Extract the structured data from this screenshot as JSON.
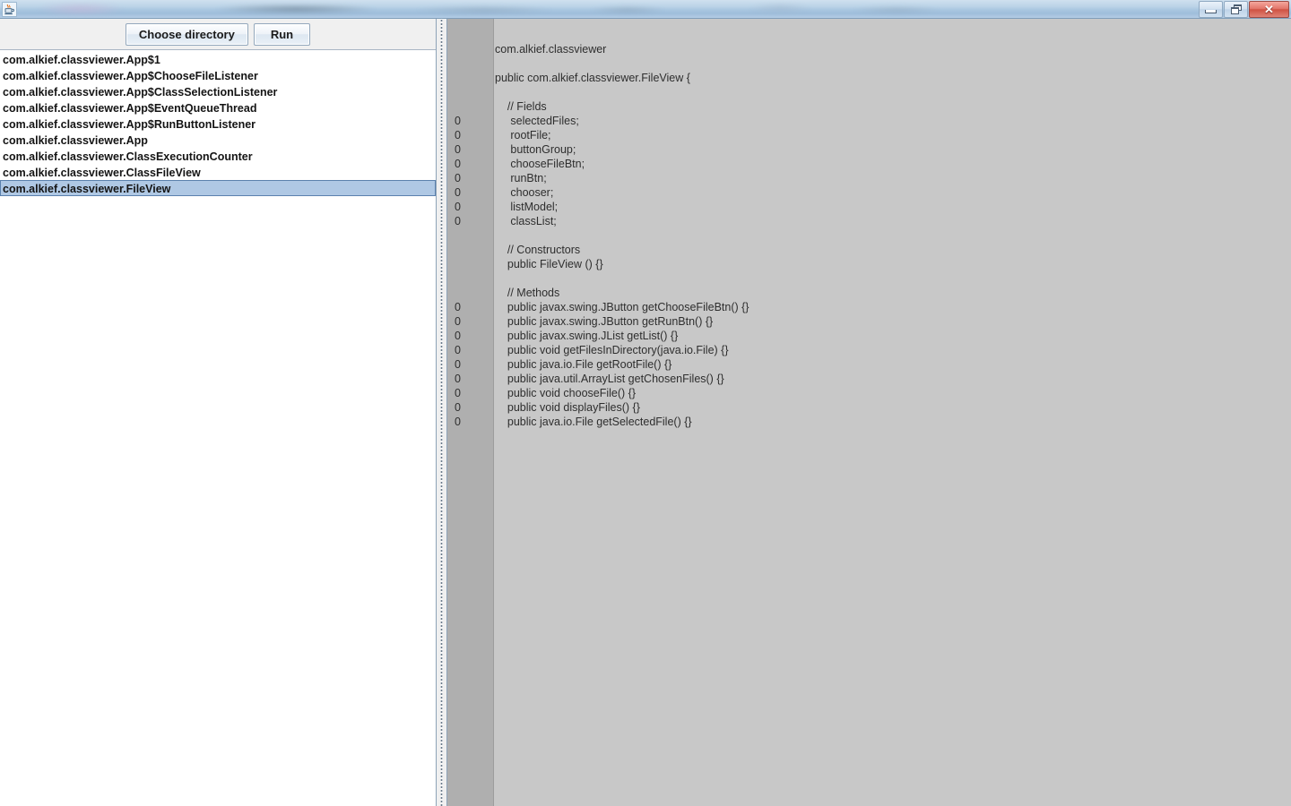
{
  "window": {
    "title": "",
    "app_icon": "java-coffee-cup-icon",
    "controls": {
      "minimize": "minimize-icon",
      "restore": "restore-icon",
      "close": "✕"
    }
  },
  "toolbar": {
    "choose_directory_label": "Choose directory",
    "run_label": "Run"
  },
  "class_list": {
    "items": [
      {
        "label": "com.alkief.classviewer.App$1",
        "selected": false
      },
      {
        "label": "com.alkief.classviewer.App$ChooseFileListener",
        "selected": false
      },
      {
        "label": "com.alkief.classviewer.App$ClassSelectionListener",
        "selected": false
      },
      {
        "label": "com.alkief.classviewer.App$EventQueueThread",
        "selected": false
      },
      {
        "label": "com.alkief.classviewer.App$RunButtonListener",
        "selected": false
      },
      {
        "label": "com.alkief.classviewer.App",
        "selected": false
      },
      {
        "label": "com.alkief.classviewer.ClassExecutionCounter",
        "selected": false
      },
      {
        "label": "com.alkief.classviewer.ClassFileView",
        "selected": false
      },
      {
        "label": "com.alkief.classviewer.FileView",
        "selected": true
      }
    ]
  },
  "code_view": {
    "lines": [
      {
        "text": "com.alkief.classviewer",
        "counter": null
      },
      {
        "text": "",
        "counter": null
      },
      {
        "text": "public com.alkief.classviewer.FileView {",
        "counter": null
      },
      {
        "text": "",
        "counter": null
      },
      {
        "text": "    // Fields",
        "counter": null
      },
      {
        "text": "     selectedFiles;",
        "counter": "0"
      },
      {
        "text": "     rootFile;",
        "counter": "0"
      },
      {
        "text": "     buttonGroup;",
        "counter": "0"
      },
      {
        "text": "     chooseFileBtn;",
        "counter": "0"
      },
      {
        "text": "     runBtn;",
        "counter": "0"
      },
      {
        "text": "     chooser;",
        "counter": "0"
      },
      {
        "text": "     listModel;",
        "counter": "0"
      },
      {
        "text": "     classList;",
        "counter": "0"
      },
      {
        "text": "",
        "counter": null
      },
      {
        "text": "    // Constructors",
        "counter": null
      },
      {
        "text": "    public FileView () {}",
        "counter": null
      },
      {
        "text": "",
        "counter": null
      },
      {
        "text": "    // Methods",
        "counter": null
      },
      {
        "text": "    public javax.swing.JButton getChooseFileBtn() {}",
        "counter": "0"
      },
      {
        "text": "    public javax.swing.JButton getRunBtn() {}",
        "counter": "0"
      },
      {
        "text": "    public javax.swing.JList getList() {}",
        "counter": "0"
      },
      {
        "text": "    public void getFilesInDirectory(java.io.File) {}",
        "counter": "0"
      },
      {
        "text": "    public java.io.File getRootFile() {}",
        "counter": "0"
      },
      {
        "text": "    public java.util.ArrayList getChosenFiles() {}",
        "counter": "0"
      },
      {
        "text": "    public void chooseFile() {}",
        "counter": "0"
      },
      {
        "text": "    public void displayFiles() {}",
        "counter": "0"
      },
      {
        "text": "    public java.io.File getSelectedFile() {}",
        "counter": "0"
      }
    ]
  },
  "colors": {
    "selection": "#afc8e4",
    "gutter_bg": "#afafaf",
    "code_bg": "#c8c8c8",
    "toolbar_bg": "#f0f0f0",
    "close_button": "#cf5243"
  }
}
